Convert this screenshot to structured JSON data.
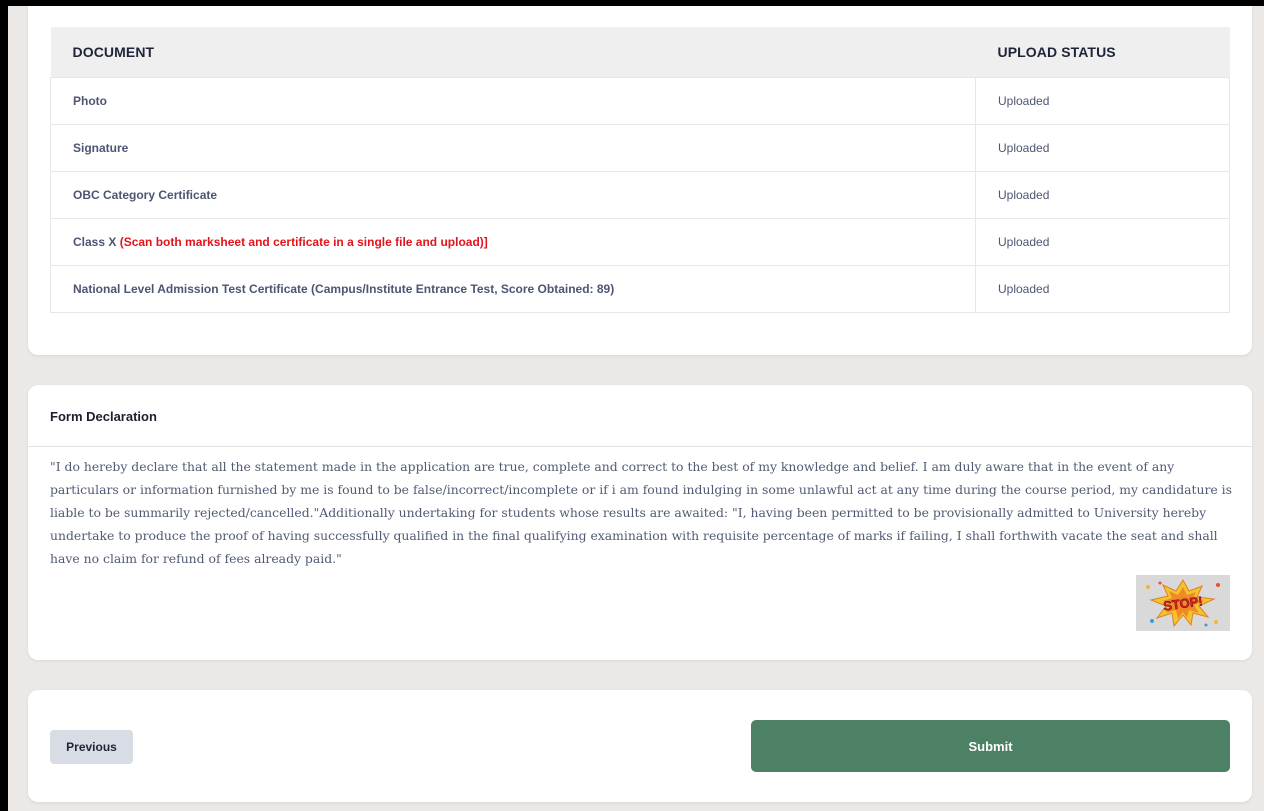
{
  "documents_table": {
    "headers": {
      "document": "DOCUMENT",
      "upload_status": "UPLOAD STATUS"
    },
    "rows": [
      {
        "name": "Photo",
        "note": "",
        "status": "Uploaded"
      },
      {
        "name": "Signature",
        "note": "",
        "status": "Uploaded"
      },
      {
        "name": "OBC Category Certificate",
        "note": "",
        "status": "Uploaded"
      },
      {
        "name": "Class X ",
        "note": "(Scan both marksheet and certificate in a single file and upload)]",
        "status": "Uploaded"
      },
      {
        "name": "National Level Admission Test Certificate (Campus/Institute Entrance Test, Score Obtained: 89)",
        "note": "",
        "status": "Uploaded"
      }
    ]
  },
  "declaration": {
    "title": "Form Declaration",
    "text": "\"I do hereby declare that all the statement made in the application are true, complete and correct to the best of my knowledge and belief. I am duly aware that in the event of any particulars or information furnished by me is found to be false/incorrect/incomplete or if i am found indulging in some unlawful act at any time during the course period, my candidature is liable to be summarily rejected/cancelled.\"Additionally undertaking for students whose results are awaited: \"I, having been permitted to be provisionally admitted to University hereby undertake to produce the proof of having successfully qualified in the final qualifying examination with requisite percentage of marks if failing, I shall forthwith vacate the seat and shall have no claim for refund of fees already paid.\"",
    "badge_text": "STOP!"
  },
  "actions": {
    "previous_label": "Previous",
    "submit_label": "Submit"
  },
  "colors": {
    "page_background": "#ebe8e6",
    "card_background": "#ffffff",
    "table_header_background": "#efefef",
    "note_red": "#e3141b",
    "submit_green": "#4d8166",
    "previous_gray": "#d8dce4"
  }
}
